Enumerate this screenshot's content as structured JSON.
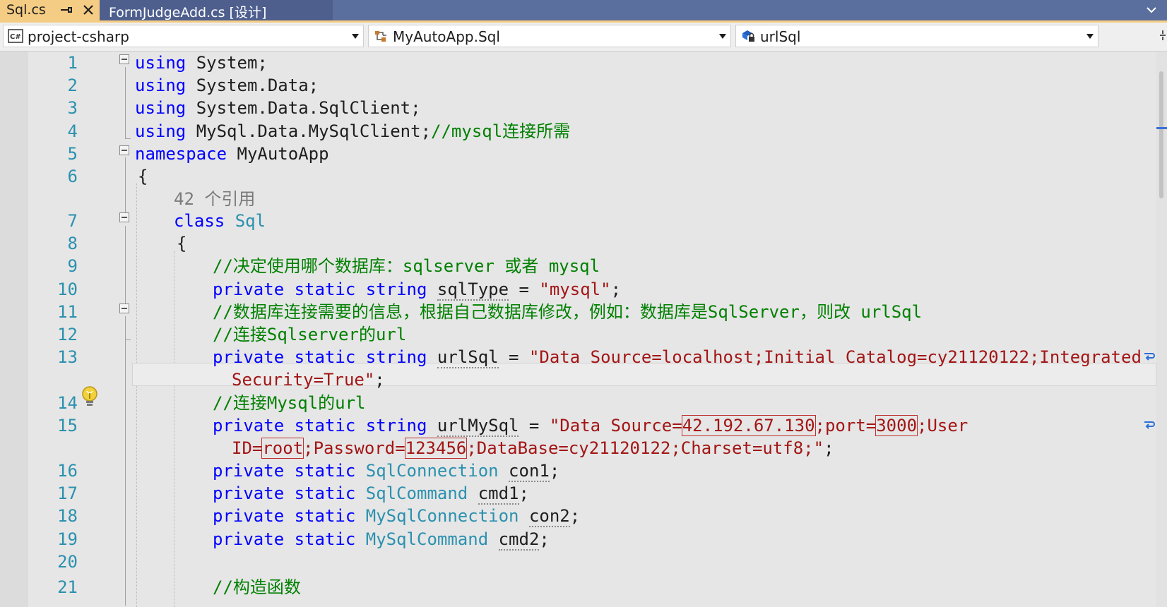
{
  "tabs": [
    {
      "label": "Sql.cs",
      "active": true
    },
    {
      "label": "FormJudgeAdd.cs [设计]",
      "active": false
    }
  ],
  "nav": {
    "project": "project-csharp",
    "type": "MyAutoApp.Sql",
    "member": "urlSql"
  },
  "line_numbers": [
    "1",
    "2",
    "3",
    "4",
    "5",
    "6",
    "7",
    "8",
    "9",
    "10",
    "11",
    "12",
    "13",
    "14",
    "15",
    "16",
    "17",
    "18",
    "19",
    "20",
    "21"
  ],
  "code": {
    "l1": {
      "kw": "using",
      "rest": " System;"
    },
    "l2": {
      "kw": "using",
      "rest": " System.Data;"
    },
    "l3": {
      "kw": "using",
      "rest": " System.Data.SqlClient;"
    },
    "l4": {
      "kw": "using",
      "rest": " MySql.Data.MySqlClient;",
      "comment": "//mysql连接所需"
    },
    "l5": {
      "kw": "namespace",
      "rest": " MyAutoApp"
    },
    "l6": {
      "text": "{"
    },
    "refs": "42 个引用",
    "l7": {
      "kw": "class",
      "name": "Sql"
    },
    "l8": {
      "text": "{"
    },
    "l9": {
      "comment": "//决定使用哪个数据库：sqlserver 或者 mysql"
    },
    "l10": {
      "kw": "private static string",
      "ident": "sqlType",
      "op": " = ",
      "str": "\"mysql\"",
      "end": ";"
    },
    "l11": {
      "comment": "//数据库连接需要的信息，根据自己数据库修改，例如：数据库是SqlServer，则改 urlSql"
    },
    "l12": {
      "comment": "//连接Sqlserver的url"
    },
    "l13": {
      "kw": "private static string",
      "ident": "urlSql",
      "op": " = ",
      "str": "\"Data Source=localhost;Initial Catalog=cy21120122;Integrated"
    },
    "l13b": {
      "str": "Security=True\"",
      "end": ";"
    },
    "l14": {
      "comment": "//连接Mysql的url"
    },
    "l15": {
      "kw": "private static string",
      "ident": "urlMySql",
      "op": " = ",
      "s1": "\"Data Source=",
      "ip": "42.192.67.130",
      "s2": ";port=",
      "port": "3000",
      "s3": ";User"
    },
    "l15b": {
      "s1": "ID=",
      "user": "root",
      "s2": ";Password=",
      "pwd": "123456",
      "s3": ";DataBase=cy21120122;Charset=utf8;\"",
      "end": ";"
    },
    "l16": {
      "kw": "private static",
      "type": "SqlConnection",
      "ident": "con1",
      "end": ";"
    },
    "l17": {
      "kw": "private static",
      "type": "SqlCommand",
      "ident": "cmd1",
      "end": ";"
    },
    "l18": {
      "kw": "private static",
      "type": "MySqlConnection",
      "ident": "con2",
      "end": ";"
    },
    "l19": {
      "kw": "private static",
      "type": "MySqlCommand",
      "ident": "cmd2",
      "end": ";"
    },
    "l21": {
      "comment": "//构造函数"
    }
  },
  "icons": {
    "pin": "pin-icon",
    "close": "close-icon",
    "csharp": "csharp-project-icon",
    "class": "class-icon",
    "field": "field-lock-icon",
    "bulb": "lightbulb-icon",
    "wrap": "word-wrap-icon"
  },
  "colors": {
    "keyword": "#0000ff",
    "type": "#2b91af",
    "comment": "#008000",
    "string": "#a31515",
    "tab_active": "#f5cc84",
    "tab_strip": "#5b6f9e"
  }
}
